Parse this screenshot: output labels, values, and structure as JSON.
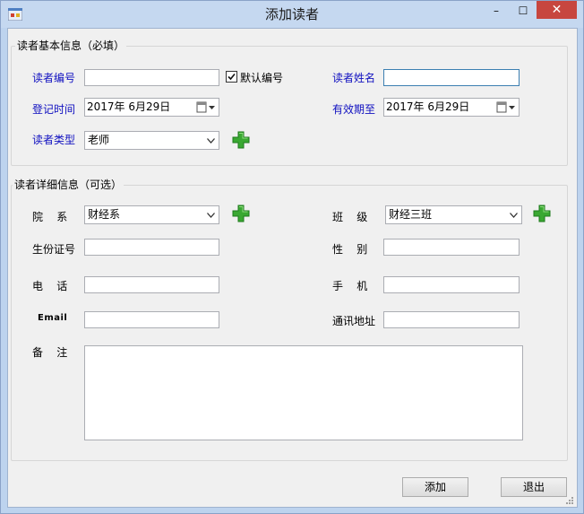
{
  "window": {
    "title": "添加读者",
    "minimize": "–",
    "maximize": "☐",
    "close": "✕"
  },
  "basic": {
    "legend": "读者基本信息（必填）",
    "reader_no_label": "读者编号",
    "reader_no_value": "",
    "default_no_label": "默认编号",
    "default_no_checked": true,
    "reader_name_label": "读者姓名",
    "reader_name_value": "",
    "register_label": "登记时间",
    "register_date": "2017年  6月29日",
    "valid_label": "有效期至",
    "valid_date": "2017年  6月29日",
    "type_label": "读者类型",
    "type_value": "老师"
  },
  "detail": {
    "legend": "读者详细信息（可选）",
    "dept_label": "院    系",
    "dept_value": "财经系",
    "class_label": "班    级",
    "class_value": "财经三班",
    "id_label": "生份证号",
    "gender_label": "性    别",
    "phone_label": "电    话",
    "mobile_label": "手    机",
    "email_label": "Email",
    "address_label": "通讯地址",
    "note_label": "备    注"
  },
  "buttons": {
    "add": "添加",
    "exit": "退出"
  },
  "colors": {
    "label_blue": "#1010c0",
    "plus_green": "#3aa832"
  }
}
